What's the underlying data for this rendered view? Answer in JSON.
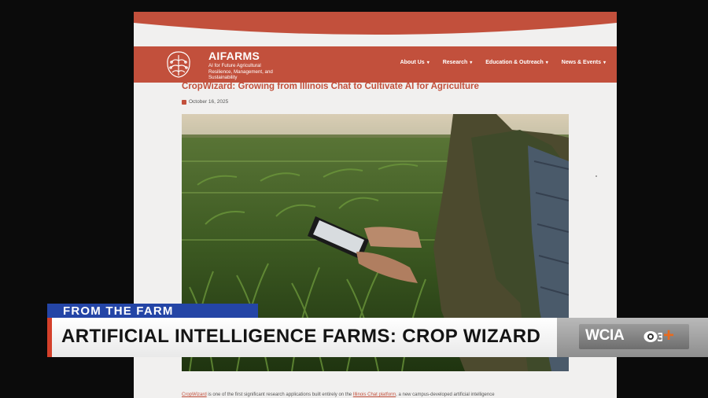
{
  "site": {
    "logo_name": "AIFARMS",
    "logo_tagline": "AI for Future Agricultural Resilience, Management, and Sustainability",
    "nav_items": [
      {
        "label": "About Us"
      },
      {
        "label": "Research"
      },
      {
        "label": "Education & Outreach"
      },
      {
        "label": "News & Events"
      }
    ]
  },
  "article": {
    "title": "CropWizard: Growing from Illinois Chat to Cultivate AI for Agriculture",
    "date": "October 16, 2025",
    "body_link_1": "CropWizard",
    "body_text_1": " is one of the first significant research applications built entirely on the ",
    "body_link_2": "Illinois Chat platform",
    "body_text_2": ", a new campus-developed artificial intelligence"
  },
  "broadcast": {
    "segment_tag": "FROM THE FARM",
    "headline": "ARTIFICIAL INTELLIGENCE FARMS: CROP WIZARD",
    "station_letters": "WCIA",
    "channel_number": "3",
    "plus": "+"
  },
  "colors": {
    "brand_red": "#c2503c",
    "tag_blue": "#2445a6",
    "accent_orange": "#e86a1e"
  },
  "icons": [
    "aifarms-logo-icon",
    "calendar-icon",
    "chevron-down-icon",
    "cbs-eye-icon"
  ]
}
